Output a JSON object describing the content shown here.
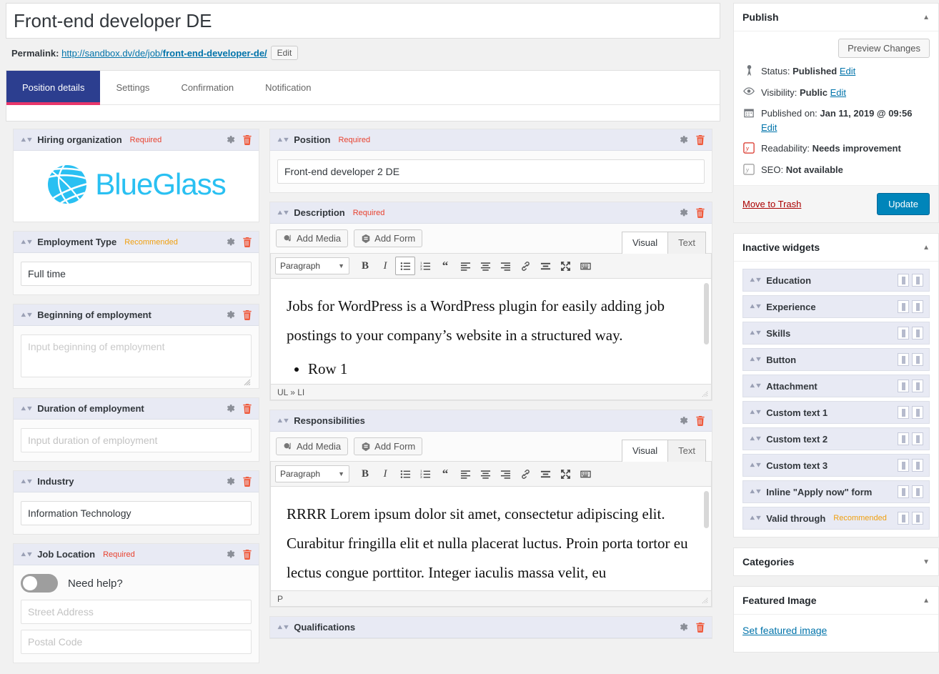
{
  "post": {
    "title": "Front-end developer DE",
    "permalink_label": "Permalink:",
    "permalink_base": "http://sandbox.dv/de/job/",
    "permalink_slug": "front-end-developer-de/",
    "edit_button": "Edit"
  },
  "tabs": [
    {
      "label": "Position details",
      "active": true
    },
    {
      "label": "Settings",
      "active": false
    },
    {
      "label": "Confirmation",
      "active": false
    },
    {
      "label": "Notification",
      "active": false
    }
  ],
  "left_panels": {
    "hiring_organization": {
      "title": "Hiring organization",
      "badge": "Required",
      "badge_type": "required",
      "logo_text": "BlueGlass"
    },
    "employment_type": {
      "title": "Employment Type",
      "badge": "Recommended",
      "badge_type": "recommended",
      "value": "Full time"
    },
    "beginning_of_employment": {
      "title": "Beginning of employment",
      "badge": "",
      "placeholder": "Input beginning of employment"
    },
    "duration_of_employment": {
      "title": "Duration of employment",
      "badge": "",
      "placeholder": "Input duration of employment"
    },
    "industry": {
      "title": "Industry",
      "badge": "",
      "value": "Information Technology"
    },
    "job_location": {
      "title": "Job Location",
      "badge": "Required",
      "badge_type": "required",
      "need_help_label": "Need help?",
      "street_placeholder": "Street Address",
      "postal_placeholder": "Postal Code"
    }
  },
  "right_panels": {
    "position": {
      "title": "Position",
      "badge": "Required",
      "value": "Front-end developer 2 DE"
    },
    "description": {
      "title": "Description",
      "badge": "Required",
      "add_media": "Add Media",
      "add_form": "Add Form",
      "tab_visual": "Visual",
      "tab_text": "Text",
      "format": "Paragraph",
      "paragraph": "Jobs for WordPress is a WordPress plugin for easily adding job postings to your company’s website in a structured way.",
      "list_item": "Row 1",
      "status_path": "UL » LI"
    },
    "responsibilities": {
      "title": "Responsibilities",
      "badge": "",
      "add_media": "Add Media",
      "add_form": "Add Form",
      "tab_visual": "Visual",
      "tab_text": "Text",
      "format": "Paragraph",
      "paragraph": "RRRR Lorem ipsum dolor sit amet, consectetur adipiscing elit. Curabitur fringilla elit et nulla placerat luctus. Proin porta tortor eu lectus congue porttitor. Integer iaculis massa velit, eu",
      "status_path": "P"
    },
    "qualifications": {
      "title": "Qualifications"
    }
  },
  "editor_toolbar": {
    "bold": "B",
    "italic": "I",
    "bullet_list": "bullet-list-icon",
    "numbered_list": "numbered-list-icon",
    "blockquote": "“",
    "align_left": "align-left-icon",
    "align_center": "align-center-icon",
    "align_right": "align-right-icon",
    "link": "link-icon",
    "read_more": "read-more-icon",
    "fullscreen": "fullscreen-icon",
    "toolbar_toggle": "toolbar-toggle-icon"
  },
  "publish": {
    "title": "Publish",
    "preview_button": "Preview Changes",
    "status_label": "Status:",
    "status_value": "Published",
    "status_edit": "Edit",
    "visibility_label": "Visibility:",
    "visibility_value": "Public",
    "visibility_edit": "Edit",
    "published_label": "Published on:",
    "published_value": "Jan 11, 2019 @ 09:56",
    "published_edit": "Edit",
    "readability_label": "Readability:",
    "readability_value": "Needs improvement",
    "seo_label": "SEO:",
    "seo_value": "Not available",
    "trash_link": "Move to Trash",
    "update_button": "Update"
  },
  "inactive_widgets": {
    "title": "Inactive widgets",
    "items": [
      {
        "label": "Education",
        "badge": ""
      },
      {
        "label": "Experience",
        "badge": ""
      },
      {
        "label": "Skills",
        "badge": ""
      },
      {
        "label": "Button",
        "badge": ""
      },
      {
        "label": "Attachment",
        "badge": ""
      },
      {
        "label": "Custom text 1",
        "badge": ""
      },
      {
        "label": "Custom text 2",
        "badge": ""
      },
      {
        "label": "Custom text 3",
        "badge": ""
      },
      {
        "label": "Inline \"Apply now\" form",
        "badge": ""
      },
      {
        "label": "Valid through",
        "badge": "Recommended"
      }
    ]
  },
  "categories": {
    "title": "Categories"
  },
  "featured_image": {
    "title": "Featured Image",
    "link": "Set featured image"
  },
  "colors": {
    "accent_tab": "#2c3e8f",
    "tab_underline": "#e8366a",
    "brand_cyan": "#29c0f2",
    "update_blue": "#0085ba",
    "required_red": "#e8422f",
    "recommended_orange": "#f0a010",
    "link_blue": "#0073aa",
    "trash_red": "#a00"
  }
}
